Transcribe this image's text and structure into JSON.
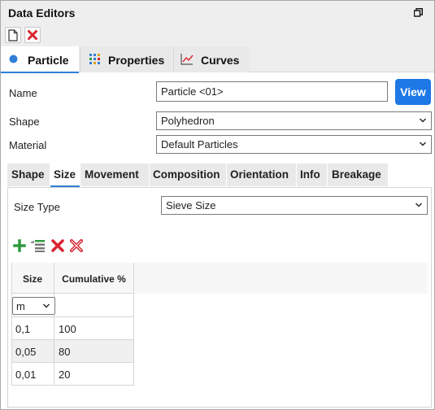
{
  "panel": {
    "title": "Data Editors"
  },
  "main_tabs": [
    {
      "label": "Particle",
      "icon": "blue-dot-icon",
      "active": true
    },
    {
      "label": "Properties",
      "icon": "properties-icon",
      "active": false
    },
    {
      "label": "Curves",
      "icon": "curves-icon",
      "active": false
    }
  ],
  "form": {
    "name_label": "Name",
    "name_value": "Particle <01>",
    "view_label": "View",
    "shape_label": "Shape",
    "shape_value": "Polyhedron",
    "material_label": "Material",
    "material_value": "Default Particles"
  },
  "sub_tabs": [
    {
      "label": "Shape",
      "active": false
    },
    {
      "label": "Size",
      "active": true
    },
    {
      "label": "Movement",
      "active": false
    },
    {
      "label": "Composition",
      "active": false
    },
    {
      "label": "Orientation",
      "active": false
    },
    {
      "label": "Info",
      "active": false
    },
    {
      "label": "Breakage",
      "active": false
    }
  ],
  "size": {
    "size_type_label": "Size Type",
    "size_type_value": "Sieve Size",
    "columns": [
      "Size",
      "Cumulative %"
    ],
    "unit": "m",
    "rows": [
      {
        "size": "0,1",
        "cumulative": "100"
      },
      {
        "size": "0,05",
        "cumulative": "80"
      },
      {
        "size": "0,01",
        "cumulative": "20"
      }
    ]
  },
  "colors": {
    "accent": "#1e78e6",
    "tab_underline": "#2f7fd8",
    "delete_red": "#d9232e",
    "add_green": "#2e9a3d"
  }
}
